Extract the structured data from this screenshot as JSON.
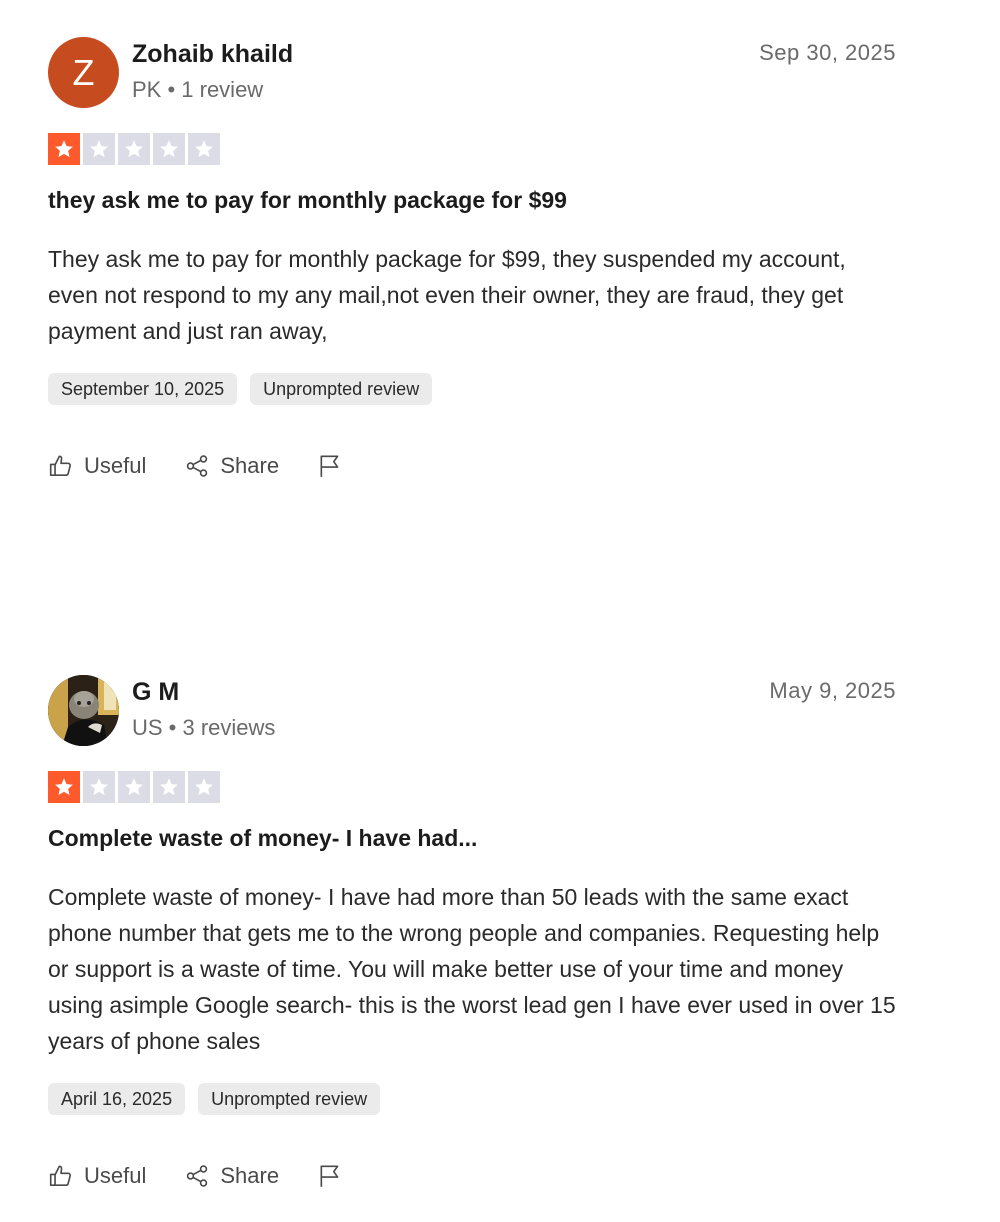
{
  "colors": {
    "star_filled": "#ff5a2c",
    "star_empty": "#dcdce6",
    "avatar_z": "#c64c20"
  },
  "actions": {
    "useful_label": "Useful",
    "share_label": "Share",
    "flag_icon": "flag-icon"
  },
  "reviews": [
    {
      "avatar_letter": "Z",
      "name": "Zohaib khaild",
      "meta": "PK • 1 review",
      "date": "Sep 30, 2025",
      "rating": 1,
      "title": "they ask me to pay for monthly package for $99",
      "body": "They ask me to pay for monthly package for $99, they suspended my account, even not respond to my any mail,not even their owner, they are fraud, they get payment and just ran away,",
      "experience_date": "September 10, 2025",
      "tag": "Unprompted review"
    },
    {
      "avatar_icon": "user-photo-avatar",
      "name": "G M",
      "meta": "US • 3 reviews",
      "date": "May 9, 2025",
      "rating": 1,
      "title": "Complete waste of money- I have had...",
      "body": "Complete waste of money- I have had more than 50 leads with the same exact phone number that gets me to the wrong people and companies. Requesting help or support is a waste of time. You will make better use of your time and money using asimple Google search- this is the worst lead gen I have ever used in over 15 years of phone sales",
      "experience_date": "April 16, 2025",
      "tag": "Unprompted review"
    }
  ]
}
